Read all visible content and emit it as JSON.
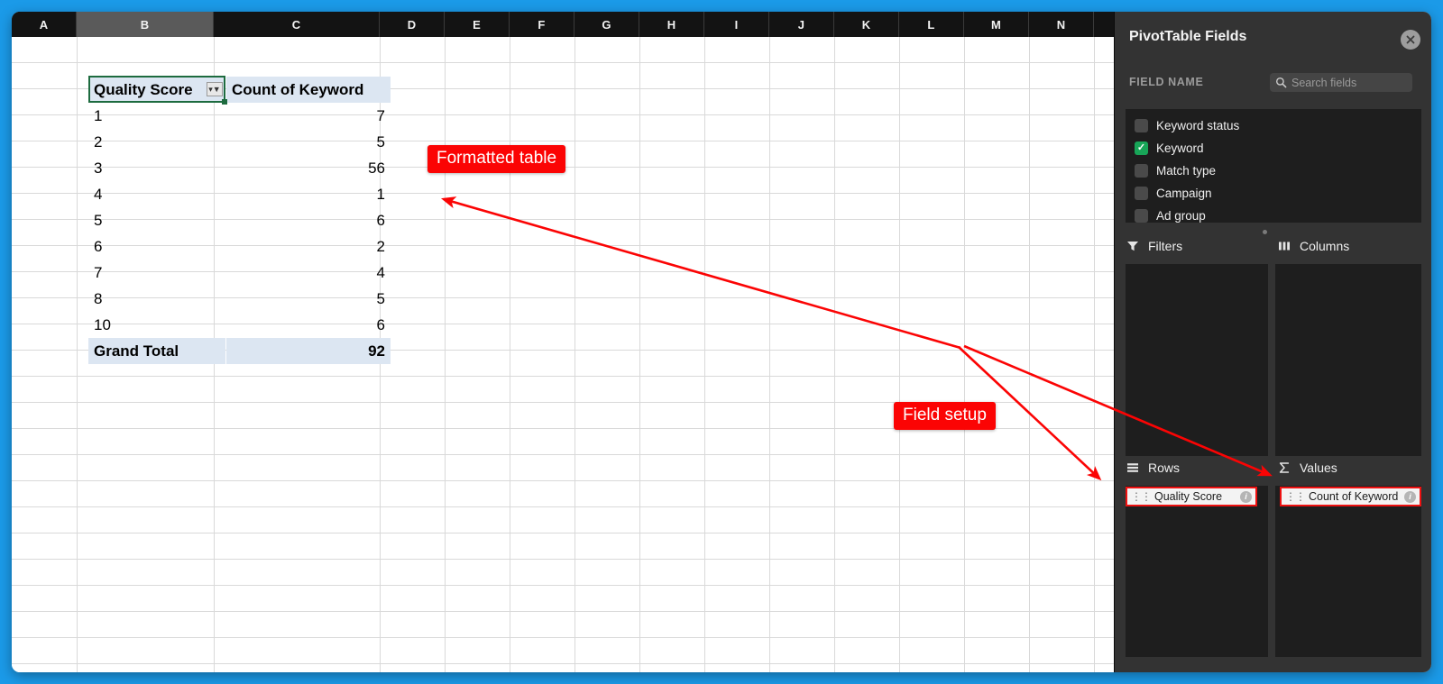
{
  "window": {
    "accent_blue": "#1b9ae8",
    "panel_bg": "#333333",
    "annotation_red": "#fb0404",
    "pivot_header_fill": "#dce6f2",
    "selection_green": "#1d6b3f"
  },
  "spreadsheet": {
    "columns": [
      "A",
      "B",
      "C",
      "D",
      "E",
      "F",
      "G",
      "H",
      "I",
      "J",
      "K",
      "L",
      "M",
      "N"
    ],
    "active_column": "B",
    "selected_cell_ref": "B3",
    "filter_icon": "filter-dropdown-icon",
    "pivot": {
      "headers": [
        "Quality Score",
        "Count of Keyword"
      ],
      "rows": [
        {
          "label": "1",
          "count": "7"
        },
        {
          "label": "2",
          "count": "5"
        },
        {
          "label": "3",
          "count": "56"
        },
        {
          "label": "4",
          "count": "1"
        },
        {
          "label": "5",
          "count": "6"
        },
        {
          "label": "6",
          "count": "2"
        },
        {
          "label": "7",
          "count": "4"
        },
        {
          "label": "8",
          "count": "5"
        },
        {
          "label": "10",
          "count": "6"
        }
      ],
      "total_label": "Grand Total",
      "total_value": "92"
    }
  },
  "panel": {
    "title": "PivotTable Fields",
    "close_icon": "close-icon",
    "field_name_label": "FIELD NAME",
    "search": {
      "placeholder": "Search fields",
      "value": "",
      "icon": "search-icon"
    },
    "fields": [
      {
        "label": "Keyword status",
        "checked": false
      },
      {
        "label": "Keyword",
        "checked": true
      },
      {
        "label": "Match type",
        "checked": false
      },
      {
        "label": "Campaign",
        "checked": false
      },
      {
        "label": "Ad group",
        "checked": false
      }
    ],
    "zones": {
      "filters": {
        "label": "Filters",
        "icon": "funnel-icon",
        "chips": []
      },
      "columns": {
        "label": "Columns",
        "icon": "columns-icon",
        "chips": []
      },
      "rows": {
        "label": "Rows",
        "icon": "rows-icon",
        "chips": [
          "Quality Score"
        ]
      },
      "values": {
        "label": "Values",
        "icon": "sigma-icon",
        "chips": [
          "Count of Keyword"
        ]
      }
    }
  },
  "annotations": [
    {
      "text": "Formatted table"
    },
    {
      "text": "Field setup"
    }
  ]
}
